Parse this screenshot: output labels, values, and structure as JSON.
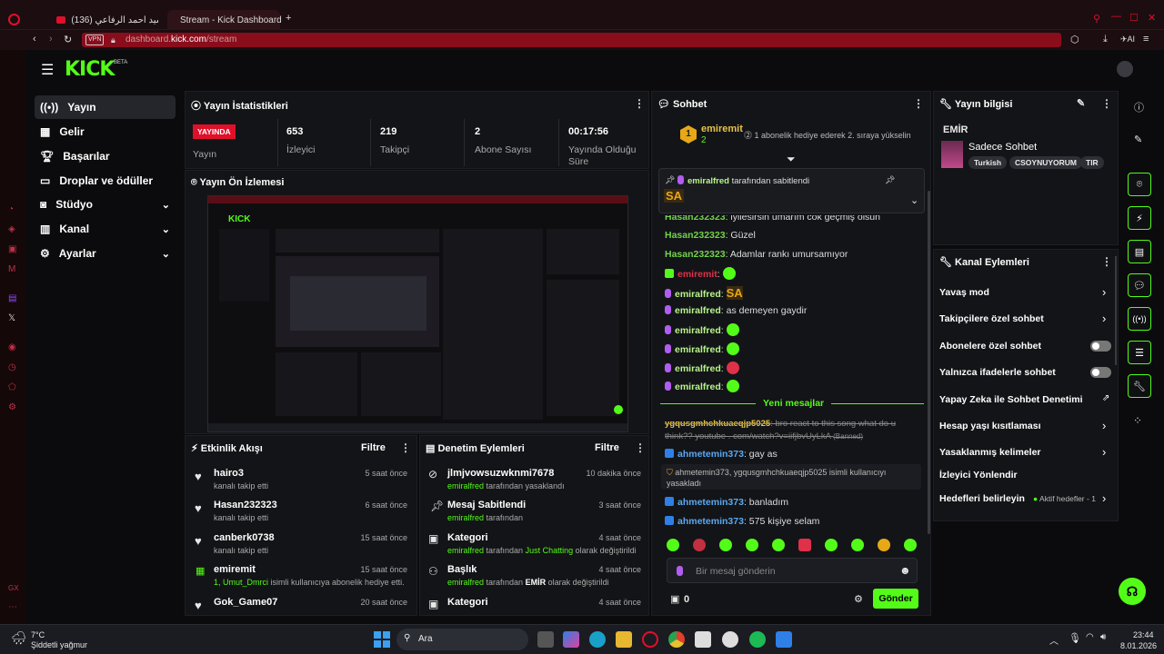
{
  "browser": {
    "tab1_title": "(136) سيد احمد الرفاعي",
    "tab2_title": "Stream - Kick Dashboard",
    "url_prefix": "dashboard.",
    "url_host": "kick.com",
    "url_path": "/stream",
    "vpn": "VPN",
    "ai_label": "AI"
  },
  "header": {
    "logo": "KICK",
    "beta": "BETA"
  },
  "nav": [
    {
      "label": "Yayın",
      "icon": "broadcast-icon"
    },
    {
      "label": "Gelir",
      "icon": "chart-icon"
    },
    {
      "label": "Başarılar",
      "icon": "trophy-icon"
    },
    {
      "label": "Droplar ve ödüller",
      "icon": "gift-icon"
    },
    {
      "label": "Stüdyo",
      "icon": "studio-icon"
    },
    {
      "label": "Kanal",
      "icon": "channel-icon"
    },
    {
      "label": "Ayarlar",
      "icon": "gear-icon"
    }
  ],
  "stats": {
    "title": "Yayın İstatistikleri",
    "live_badge": "YAYINDA",
    "live_label": "Yayın",
    "viewers": "653",
    "viewers_label": "İzleyici",
    "followers": "219",
    "followers_label": "Takipçi",
    "subs": "2",
    "subs_label": "Abone Sayısı",
    "uptime": "00:17:56",
    "uptime_label": "Yayında Olduğu Süre"
  },
  "preview": {
    "title": "Yayın Ön İzlemesi"
  },
  "activity": {
    "title": "Etkinlik Akışı",
    "filter": "Filtre",
    "items": [
      {
        "name": "hairo3",
        "sub": "kanalı takip etti",
        "time": "5 saat önce"
      },
      {
        "name": "Hasan232323",
        "sub": "kanalı takip etti",
        "time": "6 saat önce"
      },
      {
        "name": "canberk0738",
        "sub": "kanalı takip etti",
        "time": "15 saat önce"
      },
      {
        "name": "emiremit",
        "sub_green": "1, Umut_Dmrci",
        "sub": " isimli kullanıcıya abonelik hediye etti.",
        "time": "15 saat önce"
      },
      {
        "name": "Gok_Game07",
        "sub": "",
        "time": "20 saat önce"
      }
    ]
  },
  "moderation": {
    "title": "Denetim Eylemleri",
    "filter": "Filtre",
    "items": [
      {
        "name": "jlmjvowsuzwknmi7678",
        "actor": "emiralfred",
        "sub": " tarafından yasaklandı",
        "time": "10 dakika önce"
      },
      {
        "name": "Mesaj Sabitlendi",
        "actor": "emiralfred",
        "sub": " tarafından",
        "time": "3 saat önce"
      },
      {
        "name": "Kategori",
        "actor": "emiralfred",
        "sub": " tarafından ",
        "target": "Just Chatting",
        "sub2": " olarak değiştirildi",
        "time": "4 saat önce"
      },
      {
        "name": "Başlık",
        "actor": "emiralfred",
        "sub": " tarafından ",
        "target": "EMİR",
        "sub2": " olarak değiştirildi",
        "time": "4 saat önce"
      },
      {
        "name": "Kategori",
        "actor": "",
        "sub": "",
        "time": "4 saat önce"
      }
    ]
  },
  "chat": {
    "title": "Sohbet",
    "top_gifter": "emiremit",
    "top_gifter_count": "2",
    "top_gifter_rank": "1",
    "gift_text": "1 abonelik hediye ederek 2. sıraya yükselin",
    "pinned_by": "emiralfred",
    "pinned_suffix": "tarafından sabitlendi",
    "pinned_msg": "SA",
    "new_messages": "Yeni mesajlar",
    "messages": [
      {
        "user": "Hasan232323",
        "text": "iyilesirsin umarım cok geçmiş olsun"
      },
      {
        "user": "Hasan232323",
        "text": "Güzel"
      },
      {
        "user": "Hasan232323",
        "text": "Adamlar rankı umursamıyor"
      },
      {
        "user": "emiremit",
        "text": ""
      },
      {
        "user": "emiralfred",
        "text": "SA"
      },
      {
        "user": "emiralfred",
        "text": "as demeyen gaydir"
      },
      {
        "user": "emiralfred",
        "text": ""
      },
      {
        "user": "emiralfred",
        "text": ""
      },
      {
        "user": "emiralfred",
        "text": ""
      },
      {
        "user": "emiralfred",
        "text": ""
      }
    ],
    "banned_user": "ygqusgmhchkuaeqjp5025",
    "banned_text": "bro react to this song what do u think?? youtube . com/watch?v=iifjbvUyLkA",
    "banned_tag": "(Banned)",
    "m1_user": "ahmetemin373",
    "m1_text": "gay as",
    "sys_text_user1": "ahmetemin373",
    "sys_text_user2": "ygqusgmhchkuaeqjp5025",
    "sys_text": " isimli kullanıcıyı yasakladı",
    "m2_user": "ahmetemin373",
    "m2_text": "banladım",
    "m3_user": "ahmetemin373",
    "m3_text": "575 kişiye selam",
    "input_placeholder": "Bir mesaj gönderin",
    "points": "0",
    "send": "Gönder"
  },
  "streaminfo": {
    "title": "Yayın bilgisi",
    "stream_title": "EMİR",
    "category": "Sadece Sohbet",
    "tags": [
      "Turkish",
      "CSOYNUYORUM",
      "TIR"
    ]
  },
  "channel_actions": {
    "title": "Kanal Eylemleri",
    "items": [
      {
        "label": "Yavaş mod",
        "type": "chevron"
      },
      {
        "label": "Takipçilere özel sohbet",
        "type": "chevron"
      },
      {
        "label": "Abonelere özel sohbet",
        "type": "toggle"
      },
      {
        "label": "Yalnızca ifadelerle sohbet",
        "type": "toggle"
      },
      {
        "label": "Yapay Zeka ile Sohbet Denetimi",
        "type": "external"
      },
      {
        "label": "Hesap yaşı kısıtlaması",
        "type": "chevron"
      },
      {
        "label": "Yasaklanmış kelimeler",
        "type": "chevron"
      },
      {
        "label": "İzleyici Yönlendir",
        "type": "none"
      },
      {
        "label": "Hedefleri belirleyin",
        "type": "chevron"
      }
    ],
    "goals_status": "Aktif hedefler - 1"
  },
  "taskbar": {
    "weather_temp": "7°C",
    "weather_desc": "Şiddetli yağmur",
    "search": "Ara",
    "time": "23:44",
    "date": "8.01.2026"
  },
  "colors": {
    "accent": "#53fc18",
    "live": "#e0102a",
    "browser": "#8a0d1c"
  }
}
